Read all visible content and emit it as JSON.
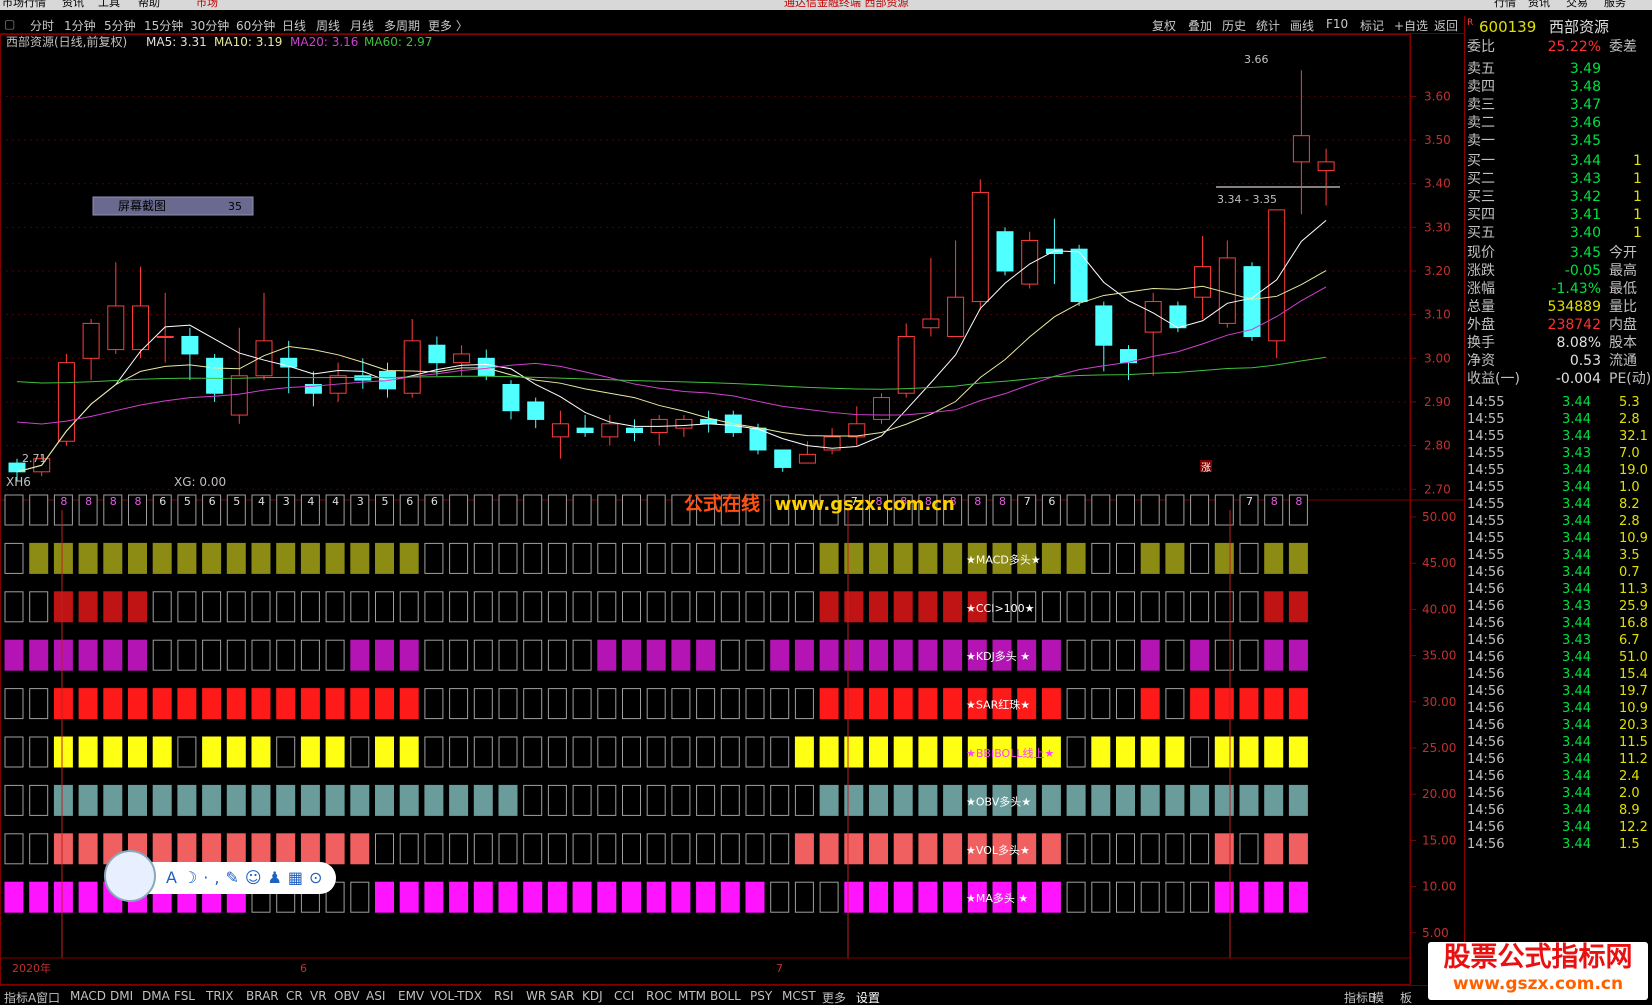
{
  "app": {
    "title": "通达信金融终端 西部资源",
    "menu": [
      "市场行情",
      "资讯",
      "工具",
      "帮助"
    ],
    "market_tab": "市场",
    "top_right": [
      "行情",
      "资讯",
      "交易",
      "服务"
    ]
  },
  "periods": [
    "分时",
    "1分钟",
    "5分钟",
    "15分钟",
    "30分钟",
    "60分钟",
    "日线",
    "周线",
    "月线",
    "多周期",
    "更多 〉"
  ],
  "toolbar_right": [
    "复权",
    "叠加",
    "历史",
    "统计",
    "画线",
    "F10",
    "标记",
    "+自选",
    "返回"
  ],
  "chart_header": {
    "name": "西部资源(日线,前复权)",
    "ma5": "MA5: 3.31",
    "ma10": "MA10: 3.19",
    "ma20": "MA20: 3.16",
    "ma60": "MA60: 2.97"
  },
  "screenshot_tag": {
    "label": "屏幕截图",
    "count": "35"
  },
  "price_markers": {
    "high": "3.66",
    "low": "2.71",
    "range": "3.34 - 3.35",
    "zhang": "涨"
  },
  "indicator_header": {
    "name": "XH6",
    "xg": "XG: 0.00"
  },
  "watermark_center": {
    "a": "公式在线",
    "b": "www.gsz x.com.cn"
  },
  "watermark_corner": {
    "a": "股票公式指标网",
    "b": "www.gszx.com.cn"
  },
  "timeline": {
    "y2020": "2020年",
    "m6": "6",
    "m7": "7"
  },
  "signal_labels": [
    "★MACD多头★",
    "★CCI>100★",
    "★KDJ多头 ★",
    "★SAR红珠★",
    "★BBIBOLL线上★",
    "★OBV多头★",
    "★VOL多头★",
    "★MA多头 ★"
  ],
  "stock": {
    "code": "600139",
    "name": "西部资源",
    "r": "R"
  },
  "orderbook": {
    "weibi": {
      "label": "委比",
      "value": "25.22%",
      "extra": "委差"
    },
    "asks": [
      {
        "label": "卖五",
        "price": "3.49"
      },
      {
        "label": "卖四",
        "price": "3.48"
      },
      {
        "label": "卖三",
        "price": "3.47"
      },
      {
        "label": "卖二",
        "price": "3.46"
      },
      {
        "label": "卖一",
        "price": "3.45"
      }
    ],
    "bids": [
      {
        "label": "买一",
        "price": "3.44"
      },
      {
        "label": "买二",
        "price": "3.43"
      },
      {
        "label": "买三",
        "price": "3.42"
      },
      {
        "label": "买四",
        "price": "3.41"
      },
      {
        "label": "买五",
        "price": "3.40"
      }
    ]
  },
  "quote": [
    {
      "label": "现价",
      "value": "3.45",
      "extra": "今开",
      "color": "#00e040"
    },
    {
      "label": "涨跌",
      "value": "-0.05",
      "extra": "最高",
      "color": "#00e040"
    },
    {
      "label": "涨幅",
      "value": "-1.43%",
      "extra": "最低",
      "color": "#00e040"
    },
    {
      "label": "总量",
      "value": "534889",
      "extra": "量比",
      "color": "#e0e000"
    },
    {
      "label": "外盘",
      "value": "238742",
      "extra": "内盘",
      "color": "#ff3030"
    },
    {
      "label": "换手",
      "value": "8.08%",
      "extra": "股本",
      "color": "#e0e0e0"
    },
    {
      "label": "净资",
      "value": "0.53",
      "extra": "流通",
      "color": "#e0e0e0"
    },
    {
      "label": "收益(一)",
      "value": "-0.004",
      "extra": "PE(动)",
      "color": "#e0e0e0"
    }
  ],
  "ticks": [
    {
      "t": "14:55",
      "p": "3.44",
      "v": "5.3"
    },
    {
      "t": "14:55",
      "p": "3.44",
      "v": "2.8"
    },
    {
      "t": "14:55",
      "p": "3.44",
      "v": "32.1"
    },
    {
      "t": "14:55",
      "p": "3.43",
      "v": "7.0"
    },
    {
      "t": "14:55",
      "p": "3.44",
      "v": "19.0"
    },
    {
      "t": "14:55",
      "p": "3.44",
      "v": "1.0"
    },
    {
      "t": "14:55",
      "p": "3.44",
      "v": "8.2"
    },
    {
      "t": "14:55",
      "p": "3.44",
      "v": "2.8"
    },
    {
      "t": "14:55",
      "p": "3.44",
      "v": "10.9"
    },
    {
      "t": "14:55",
      "p": "3.44",
      "v": "3.5"
    },
    {
      "t": "14:56",
      "p": "3.44",
      "v": "0.7"
    },
    {
      "t": "14:56",
      "p": "3.44",
      "v": "11.3"
    },
    {
      "t": "14:56",
      "p": "3.43",
      "v": "25.9"
    },
    {
      "t": "14:56",
      "p": "3.44",
      "v": "16.8"
    },
    {
      "t": "14:56",
      "p": "3.43",
      "v": "6.7"
    },
    {
      "t": "14:56",
      "p": "3.44",
      "v": "51.0"
    },
    {
      "t": "14:56",
      "p": "3.44",
      "v": "15.4"
    },
    {
      "t": "14:56",
      "p": "3.44",
      "v": "19.7"
    },
    {
      "t": "14:56",
      "p": "3.44",
      "v": "10.9"
    },
    {
      "t": "14:56",
      "p": "3.44",
      "v": "20.3"
    },
    {
      "t": "14:56",
      "p": "3.44",
      "v": "11.5"
    },
    {
      "t": "14:56",
      "p": "3.44",
      "v": "11.2"
    },
    {
      "t": "14:56",
      "p": "3.44",
      "v": "2.4"
    },
    {
      "t": "14:56",
      "p": "3.44",
      "v": "2.0"
    },
    {
      "t": "14:56",
      "p": "3.44",
      "v": "8.9"
    },
    {
      "t": "14:56",
      "p": "3.44",
      "v": "12.2"
    },
    {
      "t": "14:56",
      "p": "3.44",
      "v": "1.5"
    }
  ],
  "bottom_tabs": [
    "指标A",
    "窗口",
    "MACD",
    "DMI",
    "DMA",
    "FSL",
    "TRIX",
    "BRAR",
    "CR",
    "VR",
    "OBV",
    "ASI",
    "EMV",
    "VOL-TDX",
    "RSI",
    "WR",
    "SAR",
    "KDJ",
    "CCI",
    "ROC",
    "MTM",
    "BOLL",
    "PSY",
    "MCST",
    "更多",
    "设置"
  ],
  "bottom_right": [
    "指标B",
    "模",
    "板"
  ],
  "colors": {
    "up": "#ff3c3c",
    "down": "#50ffff",
    "ma5": "#ffffff",
    "ma10": "#e8e8a0",
    "ma20": "#d040d0",
    "ma60": "#40c040"
  },
  "chart_data": {
    "type": "candlestick",
    "price_axis": {
      "ticks": [
        "3.60",
        "3.50",
        "3.40",
        "3.30",
        "3.20",
        "3.10",
        "3.00",
        "2.90",
        "2.80",
        "2.70"
      ],
      "ylim": [
        2.68,
        3.72
      ]
    },
    "candles": [
      [
        2.76,
        2.74,
        2.77,
        2.72
      ],
      [
        2.74,
        2.77,
        2.78,
        2.73
      ],
      [
        2.81,
        2.99,
        3.01,
        2.8
      ],
      [
        3.0,
        3.08,
        3.09,
        2.95
      ],
      [
        3.02,
        3.12,
        3.22,
        3.01
      ],
      [
        3.02,
        3.12,
        3.21,
        3.0
      ],
      [
        3.05,
        3.05,
        3.15,
        2.99
      ],
      [
        3.05,
        3.01,
        3.07,
        2.95
      ],
      [
        3.0,
        2.92,
        3.01,
        2.9
      ],
      [
        2.87,
        2.96,
        3.07,
        2.85
      ],
      [
        2.96,
        3.04,
        3.15,
        2.95
      ],
      [
        3.0,
        2.98,
        3.04,
        2.92
      ],
      [
        2.94,
        2.92,
        2.97,
        2.89
      ],
      [
        2.92,
        2.96,
        2.99,
        2.9
      ],
      [
        2.96,
        2.95,
        3.0,
        2.93
      ],
      [
        2.97,
        2.93,
        2.99,
        2.91
      ],
      [
        2.92,
        3.04,
        3.09,
        2.91
      ],
      [
        3.03,
        2.99,
        3.05,
        2.96
      ],
      [
        2.99,
        3.01,
        3.03,
        2.96
      ],
      [
        3.0,
        2.96,
        3.02,
        2.95
      ],
      [
        2.94,
        2.88,
        2.95,
        2.86
      ],
      [
        2.9,
        2.86,
        2.91,
        2.84
      ],
      [
        2.82,
        2.85,
        2.88,
        2.77
      ],
      [
        2.84,
        2.83,
        2.87,
        2.82
      ],
      [
        2.82,
        2.85,
        2.87,
        2.8
      ],
      [
        2.84,
        2.83,
        2.86,
        2.81
      ],
      [
        2.83,
        2.86,
        2.87,
        2.8
      ],
      [
        2.84,
        2.86,
        2.87,
        2.82
      ],
      [
        2.86,
        2.85,
        2.88,
        2.83
      ],
      [
        2.87,
        2.83,
        2.88,
        2.82
      ],
      [
        2.84,
        2.79,
        2.85,
        2.78
      ],
      [
        2.79,
        2.75,
        2.79,
        2.74
      ],
      [
        2.76,
        2.78,
        2.81,
        2.76
      ],
      [
        2.79,
        2.82,
        2.84,
        2.78
      ],
      [
        2.82,
        2.85,
        2.89,
        2.8
      ],
      [
        2.86,
        2.91,
        2.92,
        2.85
      ],
      [
        2.92,
        3.05,
        3.08,
        2.91
      ],
      [
        3.07,
        3.09,
        3.23,
        3.05
      ],
      [
        3.05,
        3.14,
        3.27,
        3.05
      ],
      [
        3.13,
        3.38,
        3.41,
        3.11
      ],
      [
        3.29,
        3.2,
        3.3,
        3.19
      ],
      [
        3.17,
        3.27,
        3.29,
        3.16
      ],
      [
        3.25,
        3.24,
        3.32,
        3.17
      ],
      [
        3.25,
        3.13,
        3.26,
        3.12
      ],
      [
        3.12,
        3.03,
        3.13,
        2.97
      ],
      [
        3.02,
        2.99,
        3.03,
        2.95
      ],
      [
        3.06,
        3.13,
        3.15,
        2.96
      ],
      [
        3.12,
        3.07,
        3.13,
        3.06
      ],
      [
        3.14,
        3.21,
        3.28,
        3.09
      ],
      [
        3.08,
        3.23,
        3.27,
        3.07
      ],
      [
        3.21,
        3.05,
        3.22,
        3.04
      ],
      [
        3.04,
        3.34,
        3.34,
        3.0
      ],
      [
        3.45,
        3.51,
        3.66,
        3.33
      ],
      [
        3.43,
        3.45,
        3.48,
        3.35
      ]
    ],
    "indicator_axis": {
      "ticks": [
        "50.00",
        "45.00",
        "40.00",
        "35.00",
        "30.00",
        "25.00",
        "20.00",
        "15.00",
        "10.00",
        "5.00"
      ]
    },
    "xh6_counts": [
      0,
      0,
      8,
      8,
      8,
      8,
      6,
      5,
      6,
      5,
      4,
      3,
      4,
      4,
      3,
      5,
      6,
      6,
      0,
      0,
      0,
      0,
      0,
      0,
      0,
      0,
      0,
      0,
      0,
      0,
      0,
      0,
      0,
      0,
      7,
      8,
      8,
      8,
      8,
      8,
      8,
      7,
      6,
      0,
      0,
      0,
      0,
      0,
      0,
      0,
      7,
      8,
      8
    ]
  }
}
